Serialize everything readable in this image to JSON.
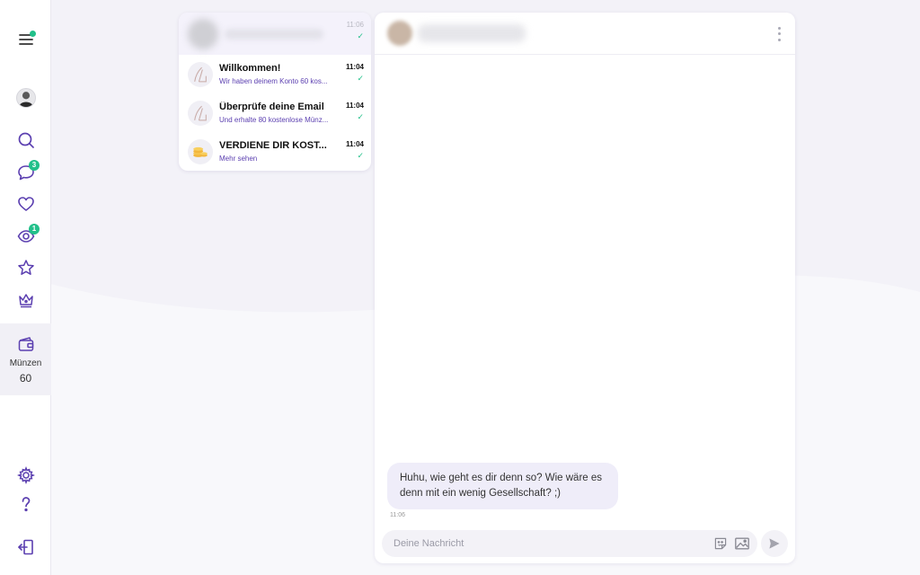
{
  "sidebar": {
    "icons": [
      "menu-icon",
      "avatar",
      "search-icon",
      "chat-icon",
      "heart-icon",
      "eye-icon",
      "star-icon",
      "crown-icon"
    ],
    "chat_badge": "3",
    "views_badge": "1",
    "coins_label": "Münzen",
    "coins_count": "60",
    "bottom_icons": [
      "gear-icon",
      "question-icon",
      "logout-icon"
    ]
  },
  "conversations": [
    {
      "name": "",
      "preview": "",
      "time": "11:06",
      "active": true,
      "blurred": true
    },
    {
      "name": "Willkommen!",
      "preview": "Wir haben deinem Konto 60 kos...",
      "time": "11:04"
    },
    {
      "name": "Überprüfe deine Email",
      "preview": "Und erhalte 80 kostenlose Münz...",
      "time": "11:04"
    },
    {
      "name": "VERDIENE DIR KOST...",
      "preview": "Mehr sehen",
      "time": "11:04"
    }
  ],
  "chat": {
    "message": "Huhu, wie geht es dir denn so? Wie wäre es denn mit ein wenig Gesellschaft? ;)",
    "message_time": "11:06",
    "input_placeholder": "Deine Nachricht"
  },
  "colors": {
    "accent": "#5b3fb0",
    "badge": "#22c08a",
    "bubble": "#efedf9",
    "background": "#f3f2f8"
  }
}
